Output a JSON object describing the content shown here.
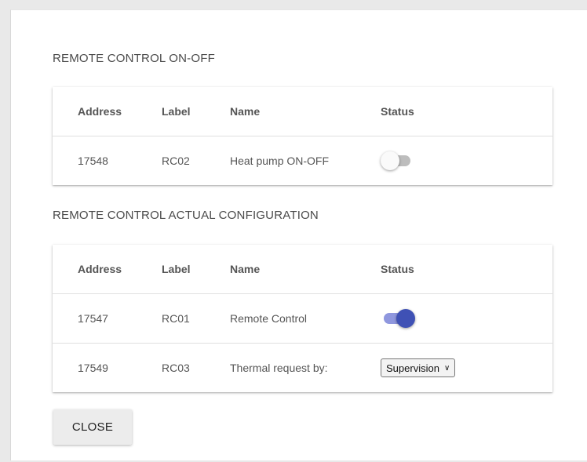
{
  "sections": [
    {
      "title": "REMOTE CONTROL ON-OFF",
      "headers": {
        "address": "Address",
        "label": "Label",
        "name": "Name",
        "status": "Status"
      },
      "rows": [
        {
          "address": "17548",
          "label": "RC02",
          "name": "Heat pump ON-OFF",
          "status_type": "toggle",
          "status_on": false
        }
      ]
    },
    {
      "title": "REMOTE CONTROL ACTUAL CONFIGURATION",
      "headers": {
        "address": "Address",
        "label": "Label",
        "name": "Name",
        "status": "Status"
      },
      "rows": [
        {
          "address": "17547",
          "label": "RC01",
          "name": "Remote Control",
          "status_type": "toggle",
          "status_on": true
        },
        {
          "address": "17549",
          "label": "RC03",
          "name": "Thermal request by:",
          "status_type": "select",
          "selected": "Supervision"
        }
      ]
    }
  ],
  "close_label": "CLOSE",
  "colors": {
    "toggle_on_thumb": "#3f51b5",
    "toggle_on_track": "#8f97de",
    "toggle_off_thumb": "#fafafa",
    "toggle_off_track": "#bdbdbd"
  }
}
